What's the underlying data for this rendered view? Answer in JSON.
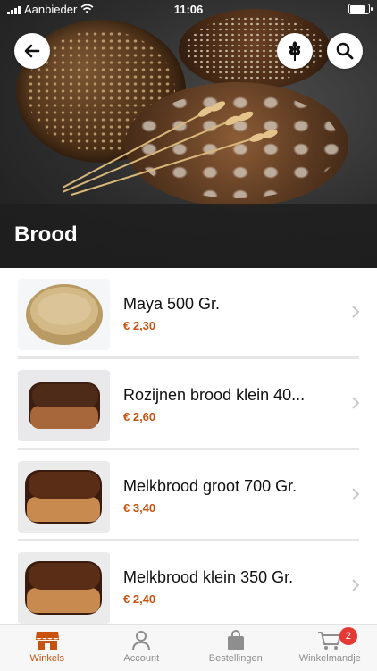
{
  "status_bar": {
    "carrier": "Aanbieder",
    "time": "11:06"
  },
  "header": {
    "title": "Brood"
  },
  "products": [
    {
      "name": "Maya 500 Gr.",
      "price": "€ 2,30",
      "image": "round-seeded-bread"
    },
    {
      "name": "Rozijnen brood klein 40...",
      "price": "€ 2,60",
      "image": "raisin-loaf"
    },
    {
      "name": "Melkbrood groot 700 Gr.",
      "price": "€ 3,40",
      "image": "milk-loaf"
    },
    {
      "name": "Melkbrood klein 350 Gr.",
      "price": "€ 2,40",
      "image": "milk-loaf"
    }
  ],
  "tabs": [
    {
      "label": "Winkels",
      "icon": "store-icon",
      "active": true
    },
    {
      "label": "Account",
      "icon": "person-icon"
    },
    {
      "label": "Bestellingen",
      "icon": "bag-icon"
    },
    {
      "label": "Winkelmandje",
      "icon": "cart-icon",
      "badge": "2"
    }
  ],
  "colors": {
    "accent": "#c8530f",
    "badge": "#e53935"
  }
}
